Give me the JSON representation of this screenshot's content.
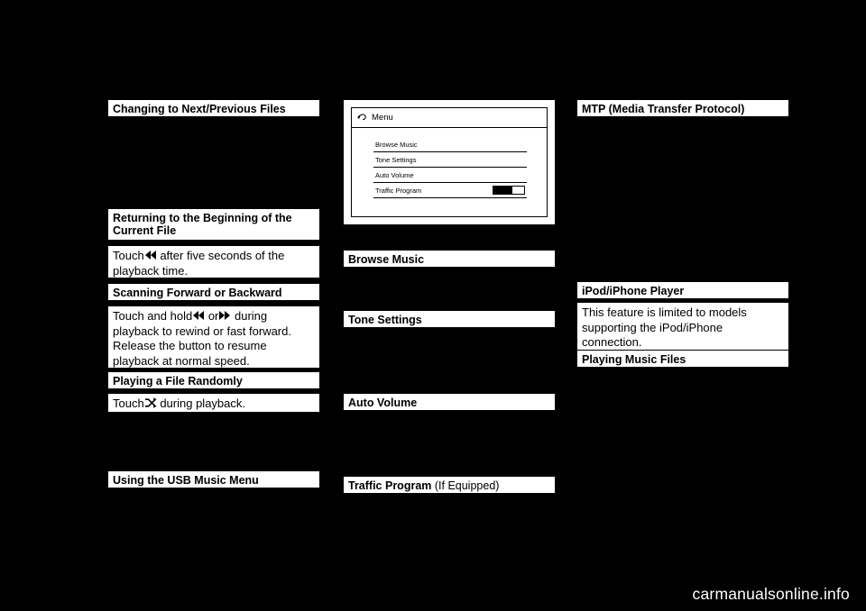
{
  "page": {
    "background_color": "#000000",
    "text_color": "#000000",
    "box_color": "#ffffff"
  },
  "column_left": {
    "headings": [
      {
        "label": "Changing to Next/Previous Files"
      },
      {
        "label": "Returning to the Beginning of the Current File"
      },
      {
        "label": "Scanning Forward or Backward"
      },
      {
        "label": "Playing a File Randomly"
      },
      {
        "label": "Using the USB Music Menu"
      }
    ],
    "body_beginning_of_file": {
      "text_before": "Touch",
      "icon": "rewind-icon",
      "text_after": "after five seconds of the playback time."
    },
    "body_scanning": {
      "text_before": "Touch and hold",
      "icon_1": "rewind-icon",
      "text_middle": "or",
      "icon_2": "fast-forward-icon",
      "text_after": "during playback to rewind or fast forward. Release the button to resume playback at normal speed."
    },
    "body_random": {
      "text_before": "Touch",
      "icon": "shuffle-icon",
      "text_after": "during playback."
    }
  },
  "column_middle": {
    "radio_screen": {
      "title": "Menu",
      "back_icon": "back-arrow-icon",
      "menu_items": [
        {
          "label": "Browse Music",
          "control": "none"
        },
        {
          "label": "Tone Settings",
          "control": "none"
        },
        {
          "label": "Auto Volume",
          "control": "none"
        },
        {
          "label": "Traffic Program",
          "control": "toggle",
          "toggle_state": "off"
        }
      ]
    },
    "headings": [
      {
        "label": "Browse Music",
        "sub": ""
      },
      {
        "label": "Tone Settings",
        "sub": ""
      },
      {
        "label": "Auto Volume",
        "sub": ""
      },
      {
        "label": "Traffic Program",
        "sub": " (If Equipped)"
      }
    ]
  },
  "column_right": {
    "headings": [
      {
        "label": "MTP (Media Transfer Protocol)"
      },
      {
        "label": "iPod/iPhone Player"
      },
      {
        "label": "Playing Music Files"
      }
    ],
    "body_ipod": {
      "text": "This feature is limited to models supporting the iPod/iPhone connection."
    }
  },
  "footer": {
    "watermark": "carmanualsonline.info"
  }
}
